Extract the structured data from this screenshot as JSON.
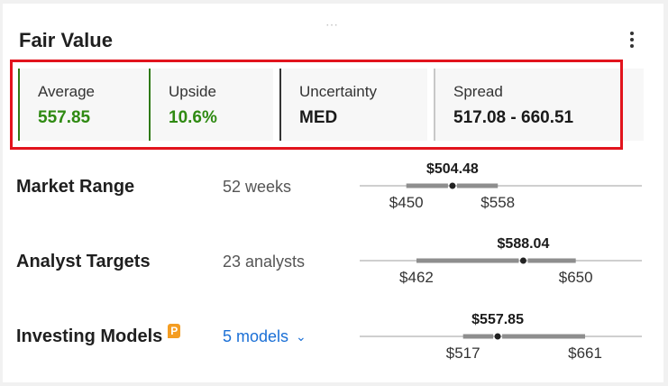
{
  "card": {
    "title": "Fair Value",
    "drag_handle": "⋯"
  },
  "stats": [
    {
      "label": "Average",
      "value": "557.85",
      "color": "#2f8a12"
    },
    {
      "label": "Upside",
      "value": "10.6%",
      "color": "#2f8a12"
    },
    {
      "label": "Uncertainty",
      "value": "MED",
      "color": "#1a1a1a"
    },
    {
      "label": "Spread",
      "value": "517.08 - 660.51",
      "color": "#1a1a1a"
    }
  ],
  "rows": {
    "market": {
      "label": "Market Range",
      "sub": "52 weeks",
      "current": "$504.48",
      "low": "$450",
      "high": "$558",
      "current_value": 504.48,
      "low_value": 450,
      "high_value": 558
    },
    "analyst": {
      "label": "Analyst Targets",
      "sub": "23 analysts",
      "current": "$588.04",
      "low": "$462",
      "high": "$650",
      "current_value": 588.04,
      "low_value": 462,
      "high_value": 650
    },
    "models": {
      "label": "Investing Models",
      "link": "5 models",
      "current": "$557.85",
      "low": "$517",
      "high": "$661",
      "current_value": 557.85,
      "low_value": 517,
      "high_value": 661,
      "pro_icon": "P"
    }
  },
  "icons": {
    "menu": "more-vertical-icon",
    "chevron": "chevron-down-icon",
    "pro": "pro-badge-icon"
  },
  "colors": {
    "accent_green": "#2f8a12",
    "highlight_red": "#e2141d",
    "link_blue": "#1a6fd6"
  }
}
